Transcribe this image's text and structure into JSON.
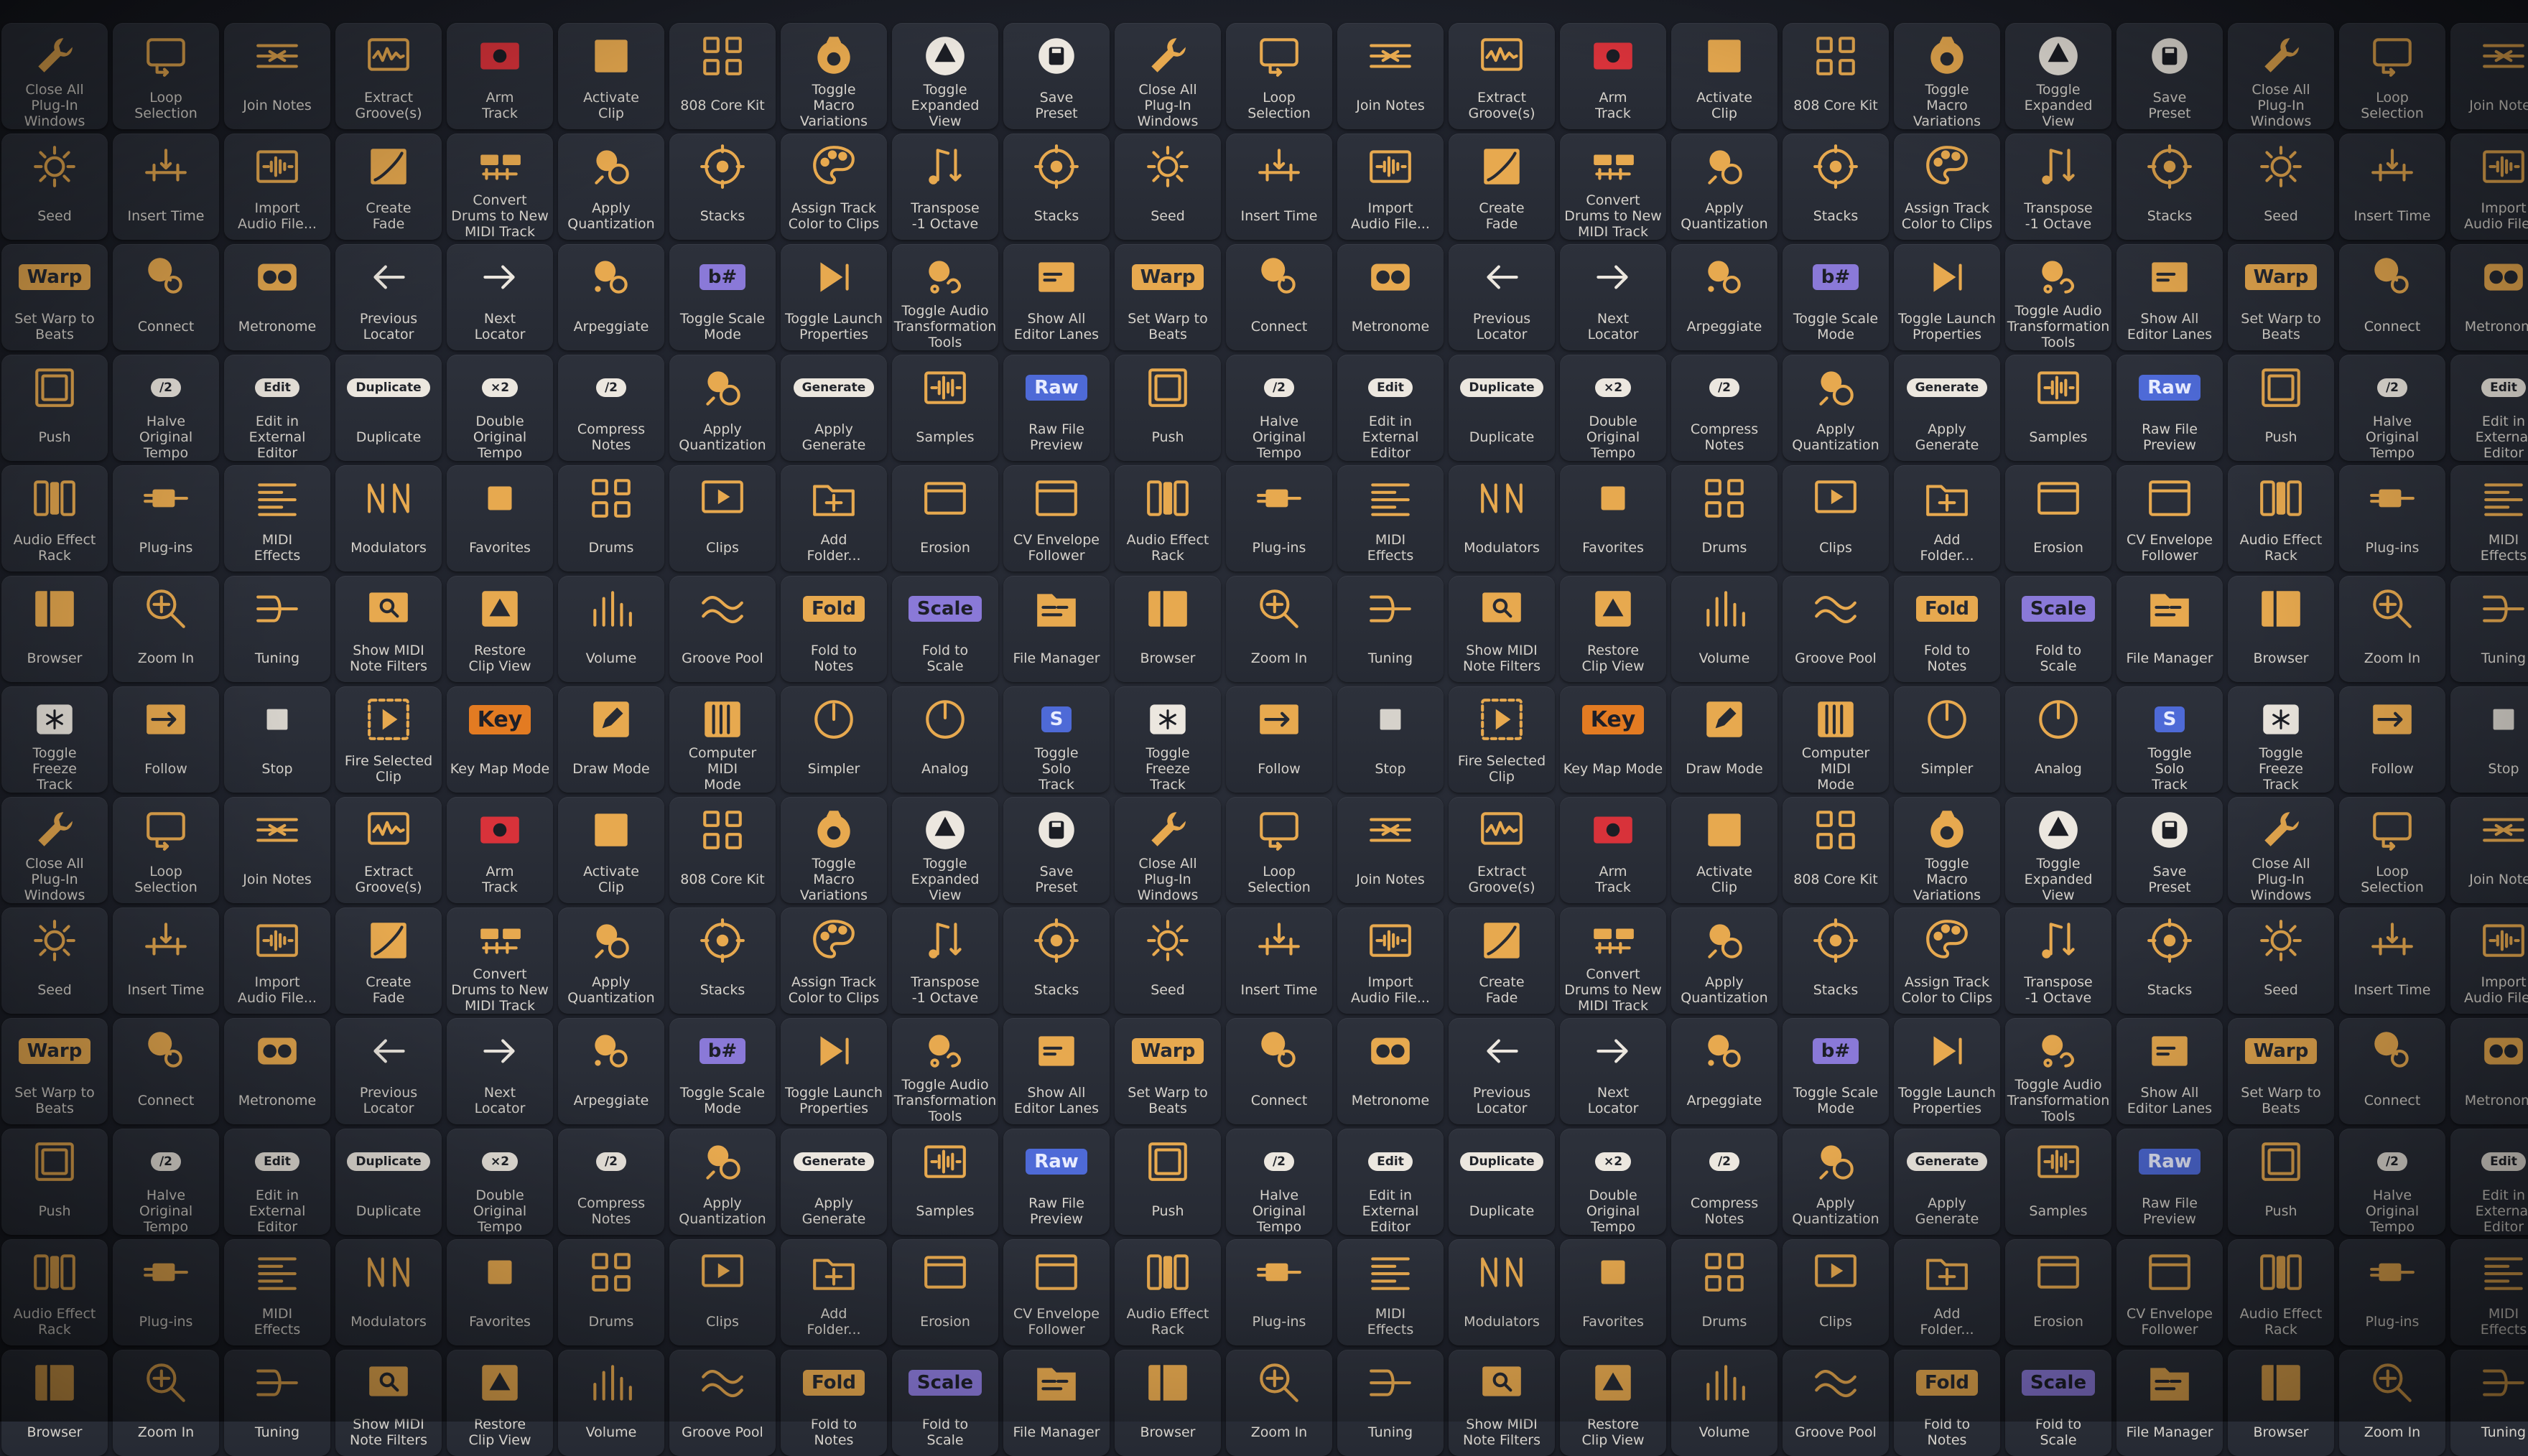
{
  "tiles": [
    {
      "icon": "wrench-icon",
      "label": "Close All\nPlug-In\nWindows"
    },
    {
      "icon": "loop-icon",
      "label": "Loop\nSelection"
    },
    {
      "icon": "join-notes-icon",
      "label": "Join Notes"
    },
    {
      "icon": "waveform-box-icon",
      "label": "Extract\nGroove(s)"
    },
    {
      "icon": "record-icon",
      "label": "Arm\nTrack"
    },
    {
      "icon": "clip-square-icon",
      "label": "Activate\nClip"
    },
    {
      "icon": "grid-icon",
      "label": "808 Core Kit"
    },
    {
      "icon": "macro-icon",
      "label": "Toggle\nMacro\nVariations"
    },
    {
      "icon": "triangle-circle-icon",
      "label": "Toggle\nExpanded\nView"
    },
    {
      "icon": "save-icon",
      "label": "Save\nPreset"
    },
    {
      "icon": "wrench-icon",
      "label": "Close All\nPlug-In\nWindows"
    },
    {
      "icon": "loop-icon",
      "label": "Loop\nSelection"
    },
    {
      "icon": "join-notes-icon",
      "label": "Join Notes"
    },
    {
      "icon": "waveform-box-icon",
      "label": "Extract\nGroove(s)"
    },
    {
      "icon": "record-icon",
      "label": "Arm\nTrack"
    },
    {
      "icon": "clip-square-icon",
      "label": "Activate\nClip"
    },
    {
      "icon": "grid-icon",
      "label": "808 Core Kit"
    },
    {
      "icon": "macro-icon",
      "label": "Toggle\nMacro\nVariations"
    },
    {
      "icon": "triangle-circle-icon",
      "label": "Toggle\nExpanded\nView"
    },
    {
      "icon": "save-icon",
      "label": "Save\nPreset"
    },
    {
      "icon": "wrench-icon",
      "label": "Close All\nPlug-In\nWindows"
    },
    {
      "icon": "loop-icon",
      "label": "Loop\nSelection"
    },
    {
      "icon": "join-notes-icon",
      "label": "Join Notes"
    },
    {
      "icon": "seed-icon",
      "label": "Seed"
    },
    {
      "icon": "insert-time-icon",
      "label": "Insert Time"
    },
    {
      "icon": "import-audio-icon",
      "label": "Import\nAudio File..."
    },
    {
      "icon": "fade-icon",
      "label": "Create\nFade"
    },
    {
      "icon": "convert-drums-icon",
      "label": "Convert\nDrums to New\nMIDI Track"
    },
    {
      "icon": "quantize-icon",
      "label": "Apply\nQuantization"
    },
    {
      "icon": "stacks-icon",
      "label": "Stacks"
    },
    {
      "icon": "palette-icon",
      "label": "Assign Track\nColor to Clips"
    },
    {
      "icon": "transpose-icon",
      "label": "Transpose\n-1 Octave"
    },
    {
      "icon": "stacks-icon",
      "label": "Stacks"
    },
    {
      "icon": "seed-icon",
      "label": "Seed"
    },
    {
      "icon": "insert-time-icon",
      "label": "Insert Time"
    },
    {
      "icon": "import-audio-icon",
      "label": "Import\nAudio File..."
    },
    {
      "icon": "fade-icon",
      "label": "Create\nFade"
    },
    {
      "icon": "convert-drums-icon",
      "label": "Convert\nDrums to New\nMIDI Track"
    },
    {
      "icon": "quantize-icon",
      "label": "Apply\nQuantization"
    },
    {
      "icon": "stacks-icon",
      "label": "Stacks"
    },
    {
      "icon": "palette-icon",
      "label": "Assign Track\nColor to Clips"
    },
    {
      "icon": "transpose-icon",
      "label": "Transpose\n-1 Octave"
    },
    {
      "icon": "stacks-icon",
      "label": "Stacks"
    },
    {
      "icon": "seed-icon",
      "label": "Seed"
    },
    {
      "icon": "insert-time-icon",
      "label": "Insert Time"
    },
    {
      "icon": "import-audio-icon",
      "label": "Import\nAudio File..."
    },
    {
      "icon": "warp-badge",
      "badge": "Warp",
      "label": "Set Warp to\nBeats"
    },
    {
      "icon": "connect-icon",
      "label": "Connect"
    },
    {
      "icon": "metronome-icon",
      "label": "Metronome"
    },
    {
      "icon": "arrow-left-icon",
      "label": "Previous\nLocator"
    },
    {
      "icon": "arrow-right-icon",
      "label": "Next\nLocator"
    },
    {
      "icon": "arpeggiate-icon",
      "label": "Arpeggiate"
    },
    {
      "icon": "scale-mode-icon",
      "badge": "b#",
      "label": "Toggle Scale\nMode"
    },
    {
      "icon": "launch-props-icon",
      "label": "Toggle Launch\nProperties"
    },
    {
      "icon": "audio-transform-icon",
      "label": "Toggle Audio\nTransformation\nTools"
    },
    {
      "icon": "editor-lanes-icon",
      "label": "Show All\nEditor Lanes"
    },
    {
      "icon": "warp-badge",
      "badge": "Warp",
      "label": "Set Warp to\nBeats"
    },
    {
      "icon": "connect-icon",
      "label": "Connect"
    },
    {
      "icon": "metronome-icon",
      "label": "Metronome"
    },
    {
      "icon": "arrow-left-icon",
      "label": "Previous\nLocator"
    },
    {
      "icon": "arrow-right-icon",
      "label": "Next\nLocator"
    },
    {
      "icon": "arpeggiate-icon",
      "label": "Arpeggiate"
    },
    {
      "icon": "scale-mode-icon",
      "badge": "b#",
      "label": "Toggle Scale\nMode"
    },
    {
      "icon": "launch-props-icon",
      "label": "Toggle Launch\nProperties"
    },
    {
      "icon": "audio-transform-icon",
      "label": "Toggle Audio\nTransformation\nTools"
    },
    {
      "icon": "editor-lanes-icon",
      "label": "Show All\nEditor Lanes"
    },
    {
      "icon": "warp-badge",
      "badge": "Warp",
      "label": "Set Warp to\nBeats"
    },
    {
      "icon": "connect-icon",
      "label": "Connect"
    },
    {
      "icon": "metronome-icon",
      "label": "Metronome"
    },
    {
      "icon": "push-icon",
      "label": "Push"
    },
    {
      "icon": "halve-tempo-pill",
      "pill": "/2",
      "label": "Halve\nOriginal\nTempo"
    },
    {
      "icon": "edit-pill",
      "pill": "Edit",
      "label": "Edit in\nExternal\nEditor"
    },
    {
      "icon": "duplicate-pill",
      "pill": "Duplicate",
      "label": "Duplicate"
    },
    {
      "icon": "double-tempo-pill",
      "pill": "×2",
      "label": "Double\nOriginal\nTempo"
    },
    {
      "icon": "compress-notes-pill",
      "pill": "/2",
      "label": "Compress\nNotes"
    },
    {
      "icon": "quantize-icon",
      "label": "Apply\nQuantization"
    },
    {
      "icon": "generate-pill",
      "pill": "Generate",
      "label": "Apply\nGenerate"
    },
    {
      "icon": "samples-icon",
      "label": "Samples"
    },
    {
      "icon": "raw-badge",
      "badge": "Raw",
      "label": "Raw File\nPreview"
    },
    {
      "icon": "push-icon",
      "label": "Push"
    },
    {
      "icon": "halve-tempo-pill",
      "pill": "/2",
      "label": "Halve\nOriginal\nTempo"
    },
    {
      "icon": "edit-pill",
      "pill": "Edit",
      "label": "Edit in\nExternal\nEditor"
    },
    {
      "icon": "duplicate-pill",
      "pill": "Duplicate",
      "label": "Duplicate"
    },
    {
      "icon": "double-tempo-pill",
      "pill": "×2",
      "label": "Double\nOriginal\nTempo"
    },
    {
      "icon": "compress-notes-pill",
      "pill": "/2",
      "label": "Compress\nNotes"
    },
    {
      "icon": "quantize-icon",
      "label": "Apply\nQuantization"
    },
    {
      "icon": "generate-pill",
      "pill": "Generate",
      "label": "Apply\nGenerate"
    },
    {
      "icon": "samples-icon",
      "label": "Samples"
    },
    {
      "icon": "raw-badge",
      "badge": "Raw",
      "label": "Raw File\nPreview"
    },
    {
      "icon": "push-icon",
      "label": "Push"
    },
    {
      "icon": "halve-tempo-pill",
      "pill": "/2",
      "label": "Halve\nOriginal\nTempo"
    },
    {
      "icon": "edit-pill",
      "pill": "Edit",
      "label": "Edit in\nExternal\nEditor"
    },
    {
      "icon": "effect-rack-icon",
      "label": "Audio Effect\nRack"
    },
    {
      "icon": "plugin-icon",
      "label": "Plug-ins"
    },
    {
      "icon": "midi-effects-icon",
      "label": "MIDI\nEffects"
    },
    {
      "icon": "modulators-icon",
      "label": "Modulators"
    },
    {
      "icon": "favorites-icon",
      "label": "Favorites"
    },
    {
      "icon": "grid-icon",
      "label": "Drums"
    },
    {
      "icon": "clips-icon",
      "label": "Clips"
    },
    {
      "icon": "add-folder-icon",
      "label": "Add\nFolder..."
    },
    {
      "icon": "erosion-icon",
      "label": "Erosion"
    },
    {
      "icon": "envelope-follower-icon",
      "label": "CV Envelope\nFollower"
    },
    {
      "icon": "effect-rack-icon",
      "label": "Audio Effect\nRack"
    },
    {
      "icon": "plugin-icon",
      "label": "Plug-ins"
    },
    {
      "icon": "midi-effects-icon",
      "label": "MIDI\nEffects"
    },
    {
      "icon": "modulators-icon",
      "label": "Modulators"
    },
    {
      "icon": "favorites-icon",
      "label": "Favorites"
    },
    {
      "icon": "grid-icon",
      "label": "Drums"
    },
    {
      "icon": "clips-icon",
      "label": "Clips"
    },
    {
      "icon": "add-folder-icon",
      "label": "Add\nFolder..."
    },
    {
      "icon": "erosion-icon",
      "label": "Erosion"
    },
    {
      "icon": "envelope-follower-icon",
      "label": "CV Envelope\nFollower"
    },
    {
      "icon": "effect-rack-icon",
      "label": "Audio Effect\nRack"
    },
    {
      "icon": "plugin-icon",
      "label": "Plug-ins"
    },
    {
      "icon": "midi-effects-icon",
      "label": "MIDI\nEffects"
    },
    {
      "icon": "browser-icon",
      "label": "Browser"
    },
    {
      "icon": "zoom-in-icon",
      "label": "Zoom In"
    },
    {
      "icon": "tuning-icon",
      "label": "Tuning"
    },
    {
      "icon": "midi-filter-icon",
      "label": "Show MIDI\nNote Filters"
    },
    {
      "icon": "restore-clip-icon",
      "label": "Restore\nClip View"
    },
    {
      "icon": "volume-icon",
      "label": "Volume"
    },
    {
      "icon": "groove-pool-icon",
      "label": "Groove Pool"
    },
    {
      "icon": "fold-badge",
      "badge": "Fold",
      "label": "Fold to\nNotes"
    },
    {
      "icon": "scale-badge",
      "badge": "Scale",
      "label": "Fold to\nScale"
    },
    {
      "icon": "file-manager-icon",
      "label": "File Manager"
    },
    {
      "icon": "browser-icon",
      "label": "Browser"
    },
    {
      "icon": "zoom-in-icon",
      "label": "Zoom In"
    },
    {
      "icon": "tuning-icon",
      "label": "Tuning"
    },
    {
      "icon": "midi-filter-icon",
      "label": "Show MIDI\nNote Filters"
    },
    {
      "icon": "restore-clip-icon",
      "label": "Restore\nClip View"
    },
    {
      "icon": "volume-icon",
      "label": "Volume"
    },
    {
      "icon": "groove-pool-icon",
      "label": "Groove Pool"
    },
    {
      "icon": "fold-badge",
      "badge": "Fold",
      "label": "Fold to\nNotes"
    },
    {
      "icon": "scale-badge",
      "badge": "Scale",
      "label": "Fold to\nScale"
    },
    {
      "icon": "file-manager-icon",
      "label": "File Manager"
    },
    {
      "icon": "browser-icon",
      "label": "Browser"
    },
    {
      "icon": "zoom-in-icon",
      "label": "Zoom In"
    },
    {
      "icon": "tuning-icon",
      "label": "Tuning"
    },
    {
      "icon": "freeze-icon",
      "label": "Toggle\nFreeze\nTrack"
    },
    {
      "icon": "follow-icon",
      "label": "Follow"
    },
    {
      "icon": "stop-icon",
      "label": "Stop"
    },
    {
      "icon": "fire-clip-icon",
      "label": "Fire Selected\nClip"
    },
    {
      "icon": "key-badge",
      "badge": "Key",
      "label": "Key Map Mode"
    },
    {
      "icon": "draw-mode-icon",
      "label": "Draw Mode"
    },
    {
      "icon": "computer-midi-icon",
      "label": "Computer MIDI\nMode"
    },
    {
      "icon": "simpler-icon",
      "label": "Simpler"
    },
    {
      "icon": "analog-icon",
      "label": "Analog"
    },
    {
      "icon": "solo-badge",
      "badge": "S",
      "label": "Toggle\nSolo\nTrack"
    },
    {
      "icon": "freeze-icon",
      "label": "Toggle\nFreeze\nTrack"
    },
    {
      "icon": "follow-icon",
      "label": "Follow"
    },
    {
      "icon": "stop-icon",
      "label": "Stop"
    },
    {
      "icon": "fire-clip-icon",
      "label": "Fire Selected\nClip"
    },
    {
      "icon": "key-badge",
      "badge": "Key",
      "label": "Key Map Mode"
    },
    {
      "icon": "draw-mode-icon",
      "label": "Draw Mode"
    },
    {
      "icon": "computer-midi-icon",
      "label": "Computer MIDI\nMode"
    },
    {
      "icon": "simpler-icon",
      "label": "Simpler"
    },
    {
      "icon": "analog-icon",
      "label": "Analog"
    },
    {
      "icon": "solo-badge",
      "badge": "S",
      "label": "Toggle\nSolo\nTrack"
    },
    {
      "icon": "freeze-icon",
      "label": "Toggle\nFreeze\nTrack"
    },
    {
      "icon": "follow-icon",
      "label": "Follow"
    },
    {
      "icon": "stop-icon",
      "label": "Stop"
    }
  ]
}
